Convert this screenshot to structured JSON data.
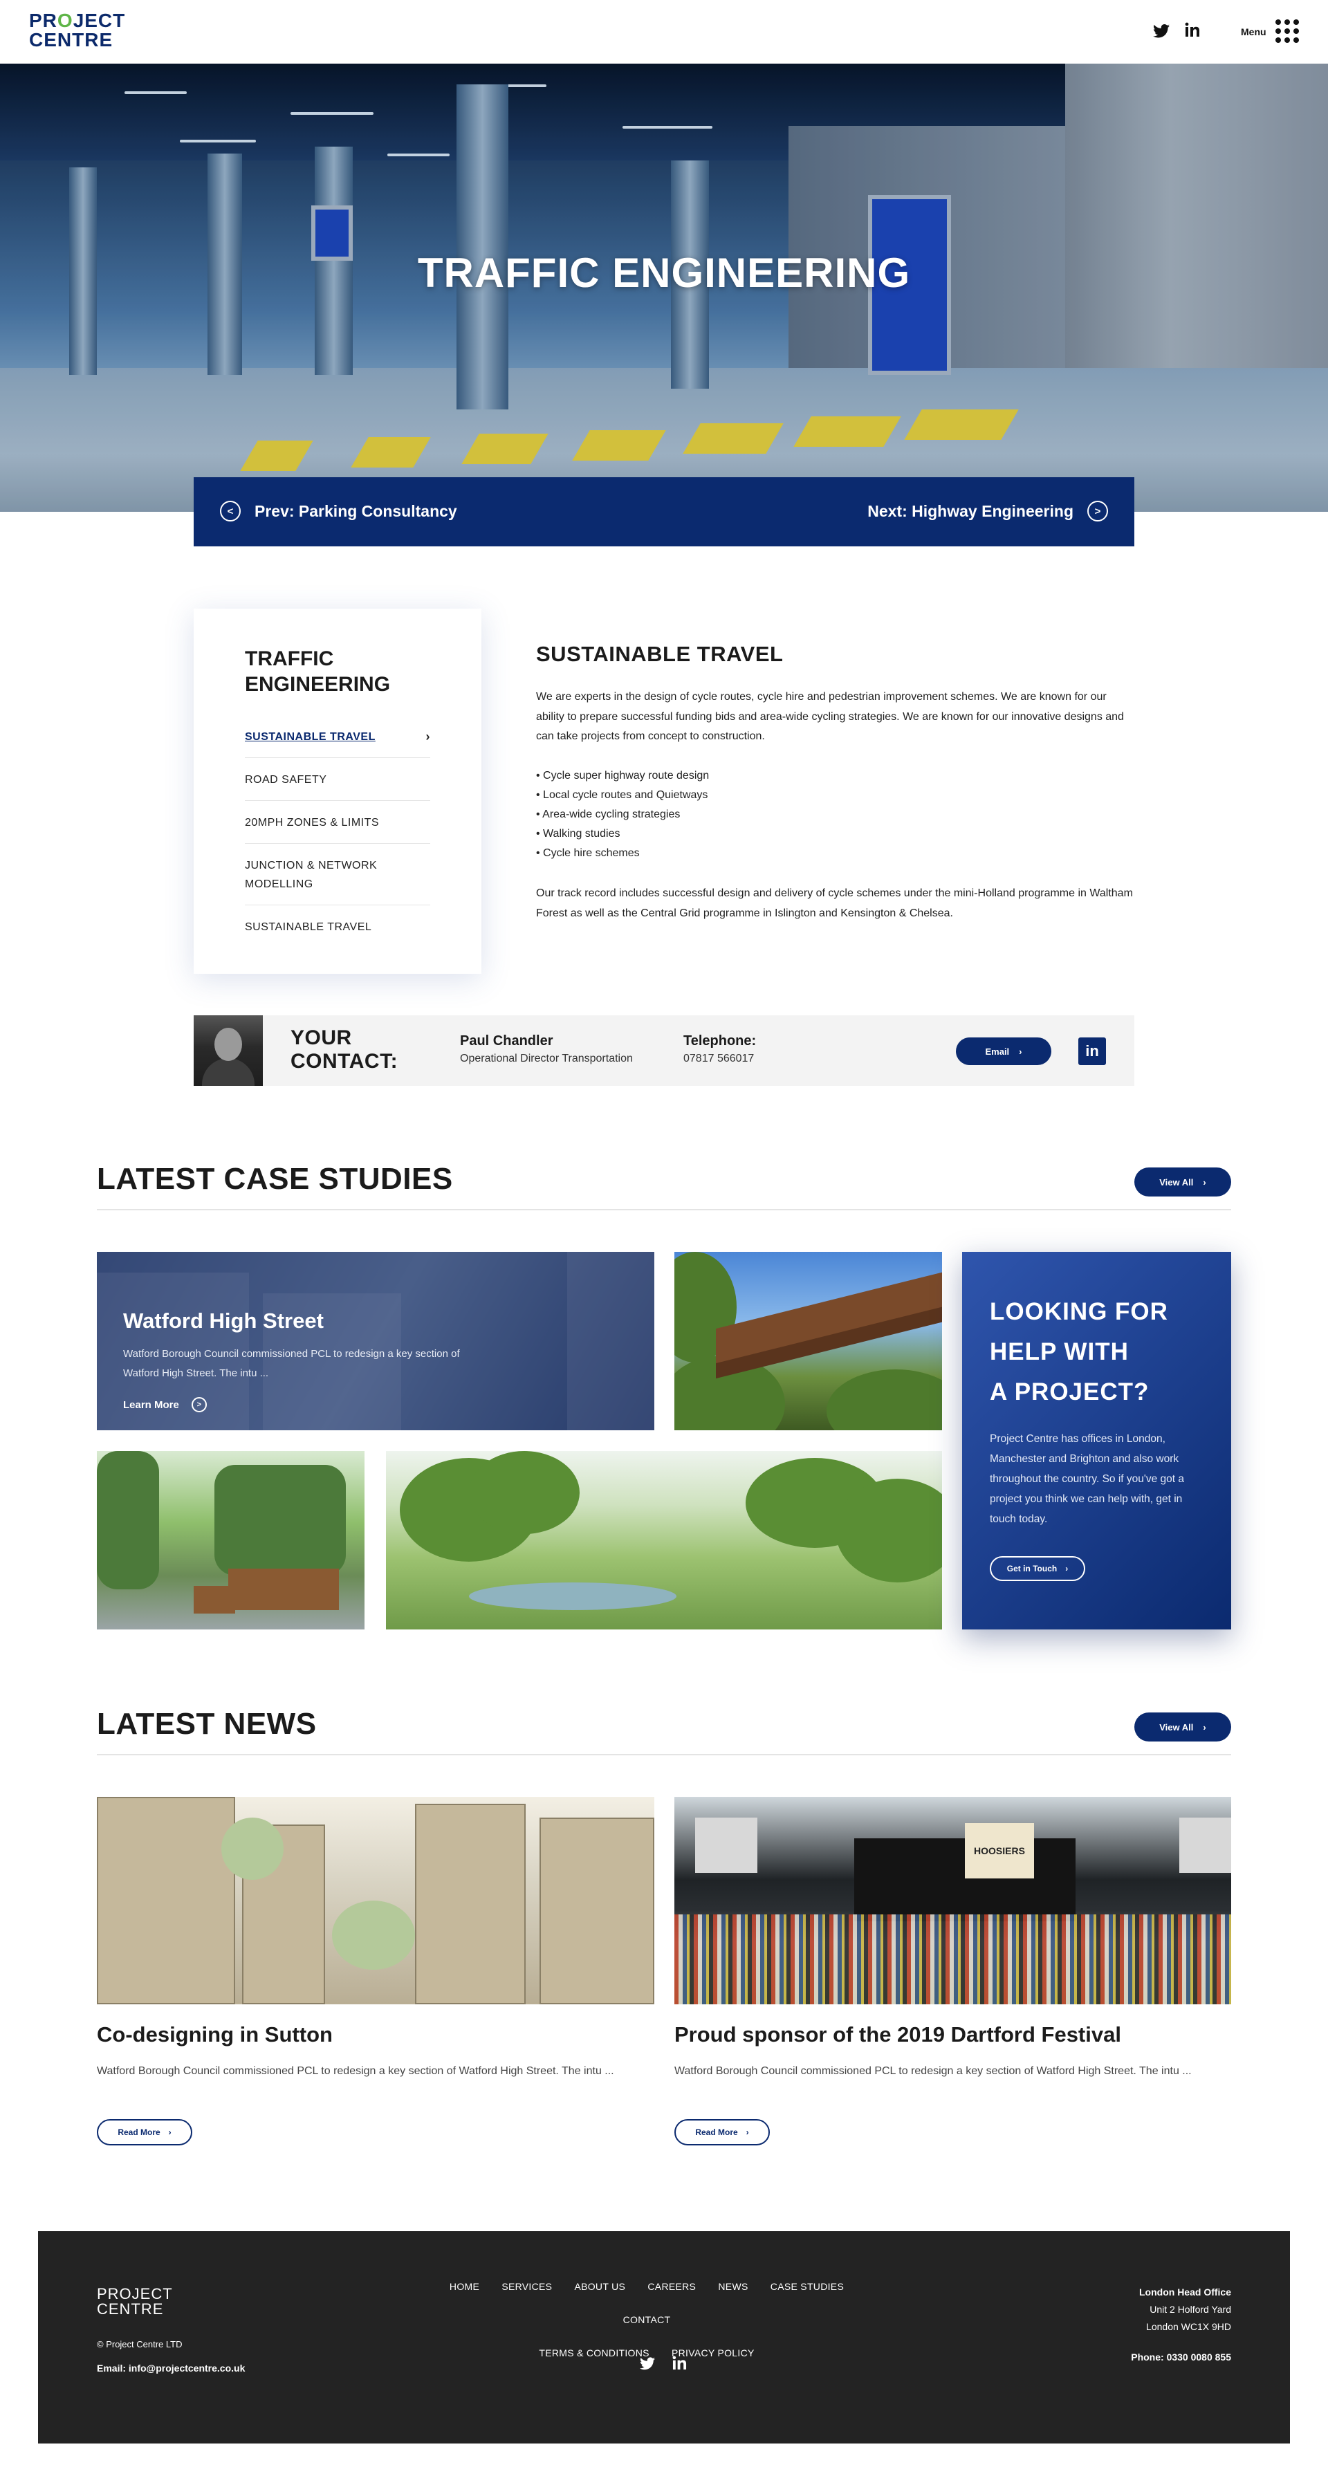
{
  "header": {
    "logo_line1": "PROJECT",
    "logo_line2": "CENTRE",
    "twitter_icon": "twitter-icon",
    "linkedin_icon": "linkedin-icon",
    "menu_label": "Menu"
  },
  "hero": {
    "title": "TRAFFIC ENGINEERING"
  },
  "pager": {
    "prev_label": "Prev: Parking Consultancy",
    "next_label": "Next: Highway Engineering"
  },
  "sidebar": {
    "title": "TRAFFIC ENGINEERING",
    "items": [
      {
        "label": "SUSTAINABLE TRAVEL",
        "active": true
      },
      {
        "label": "ROAD SAFETY"
      },
      {
        "label": "20MPH ZONES & LIMITS"
      },
      {
        "label": "JUNCTION & NETWORK MODELLING"
      },
      {
        "label": "SUSTAINABLE TRAVEL"
      }
    ]
  },
  "content": {
    "title": "SUSTAINABLE TRAVEL",
    "intro": "We are experts in the design of cycle routes, cycle hire and pedestrian improvement schemes. We are known for our ability to prepare successful funding bids and area-wide cycling strategies. We are known for our innovative designs and can take projects from concept to construction.",
    "bullets": [
      "• Cycle super highway route design",
      "• Local cycle routes and Quietways",
      "• Area-wide cycling strategies",
      "• Walking studies",
      "• Cycle hire schemes"
    ],
    "outro": "Our track record includes successful design and delivery of cycle schemes under the mini-Holland programme in Waltham Forest as well as the Central Grid programme in Islington and Kensington & Chelsea."
  },
  "contact": {
    "heading": "YOUR CONTACT:",
    "name": "Paul Chandler",
    "role": "Operational Director Transportation",
    "telephone_label": "Telephone:",
    "telephone": "07817 566017",
    "email_button": "Email"
  },
  "case_studies": {
    "title": "LATEST CASE STUDIES",
    "view_all": "View All",
    "featured": {
      "title": "Watford High Street",
      "text": "Watford Borough Council commissioned PCL to redesign a key section of Watford High Street. The intu ...",
      "link": "Learn More"
    },
    "help": {
      "title": "LOOKING FOR HELP WITH A PROJECT?",
      "text": "Project Centre has offices in London, Manchester and Brighton and also work throughout the country. So if you've got a project you think we can help with, get in touch today.",
      "button": "Get in Touch"
    }
  },
  "news": {
    "title": "LATEST NEWS",
    "view_all": "View All",
    "items": [
      {
        "title": "Co-designing in Sutton",
        "text": "Watford Borough Council commissioned PCL to redesign a key section of Watford High Street. The intu ...",
        "button": "Read More"
      },
      {
        "title": "Proud sponsor of the 2019 Dartford Festival",
        "text": "Watford Borough Council commissioned PCL to redesign a key section of Watford High Street. The intu ...",
        "button": "Read More",
        "banner": "HOOSIERS"
      }
    ]
  },
  "footer": {
    "logo_line1": "PROJECT",
    "logo_line2": "CENTRE",
    "copyright": "© Project Centre LTD",
    "email": "Email: info@projectcentre.co.uk",
    "nav": [
      "HOME",
      "SERVICES",
      "ABOUT US",
      "CAREERS",
      "NEWS",
      "CASE STUDIES",
      "CONTACT",
      "TERMS & CONDITIONS",
      "PRIVACY POLICY"
    ],
    "address_heading": "London Head Office",
    "address_line1": "Unit 2 Holford Yard",
    "address_line2": "London WC1X 9HD",
    "phone": "Phone: 0330 0080 855"
  },
  "colors": {
    "navy": "#0b2a6f",
    "logo_green": "#5fb548",
    "footer_bg": "#232323"
  }
}
